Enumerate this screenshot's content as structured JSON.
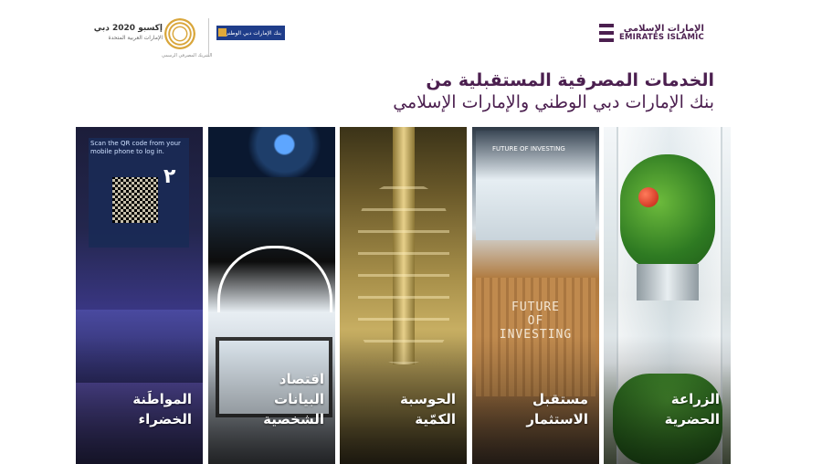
{
  "header": {
    "emirates_islamic": {
      "arabic": "الإمارات الإسلامي",
      "english": "EMIRATES ISLAMIC",
      "brand_color": "#4b1f4f"
    },
    "enbd": {
      "name": "بنك الإمارات دبي الوطني",
      "brand_color": "#1f3d8a"
    },
    "expo": {
      "title": "إكسبو 2020 دبي",
      "subtitle": "الإمارات العربية المتحدة",
      "partner": "الشريك المصرفي الرسمي"
    }
  },
  "headline": {
    "line1": "الخدمات المصرفية المستقبلية من",
    "line2": "بنك الإمارات دبي الوطني والإمارات الإسلامي"
  },
  "panels": [
    {
      "label": "المواطَنة\nالخضراء",
      "screen_text": "Scan the QR code from your\nmobile phone to log in.",
      "screen_number": "٢"
    },
    {
      "label": "اقتصاد\nالبيانات\nالشخصية"
    },
    {
      "label": "الحوسبة\nالكمّية"
    },
    {
      "label": "مستقبل\nالاستثمار",
      "screen_text": "FUTURE OF INVESTING",
      "engraving": "FUTURE\nOF\nINVESTING"
    },
    {
      "label": "الزراعة\nالحضرية"
    }
  ]
}
